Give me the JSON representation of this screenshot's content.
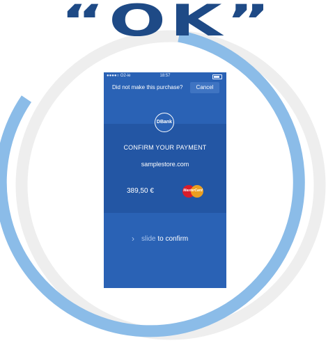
{
  "headline": "“OK”",
  "phone": {
    "status": {
      "carrier": "●●●●○ O2-ie",
      "time": "18:57"
    },
    "topbar": {
      "question": "Did not make this purchase?",
      "cancel_label": "Cancel"
    },
    "logo": "DBank",
    "confirm_title": "CONFIRM YOUR PAYMENT",
    "store": "samplestore.com",
    "amount": "389,50 €",
    "card_brand": "MasterCard",
    "slide": {
      "chevron": "›",
      "prefix": "slide",
      "suffix": " to confirm"
    }
  },
  "colors": {
    "headline": "#1e4a86",
    "ring": "#8bbce8",
    "ring_gap": "#eeeeee",
    "phone_bg": "#2a62b5",
    "panel_bg": "#2356a4"
  }
}
